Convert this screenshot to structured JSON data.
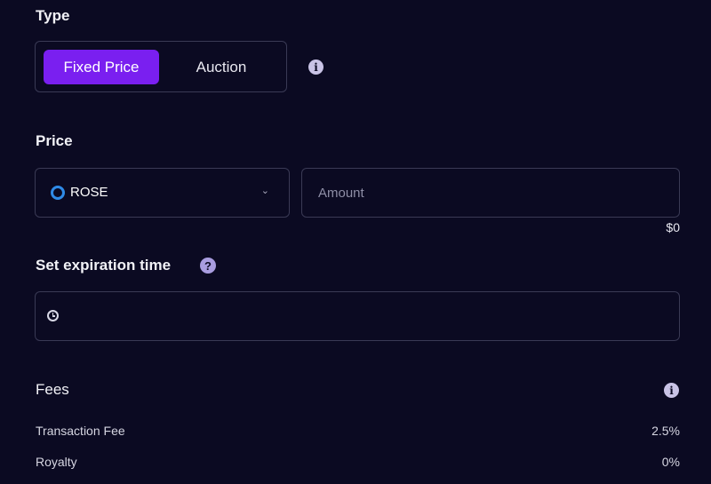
{
  "type_section": {
    "title": "Type",
    "options": [
      "Fixed Price",
      "Auction"
    ],
    "selected": "Fixed Price"
  },
  "price_section": {
    "title": "Price",
    "currency": "ROSE",
    "amount_placeholder": "Amount",
    "usd_value": "$0"
  },
  "expiration_section": {
    "title": "Set expiration time",
    "help_glyph": "?"
  },
  "fees_section": {
    "title": "Fees",
    "rows": [
      {
        "label": "Transaction Fee",
        "value": "2.5%"
      },
      {
        "label": "Royalty",
        "value": "0%"
      }
    ]
  },
  "icons": {
    "info_glyph": "i",
    "chevron_glyph": "⌄"
  },
  "colors": {
    "background": "#0b0a22",
    "accent": "#7a1ff0",
    "border": "#3a3a55",
    "rose_logo": "#2f8be8"
  }
}
